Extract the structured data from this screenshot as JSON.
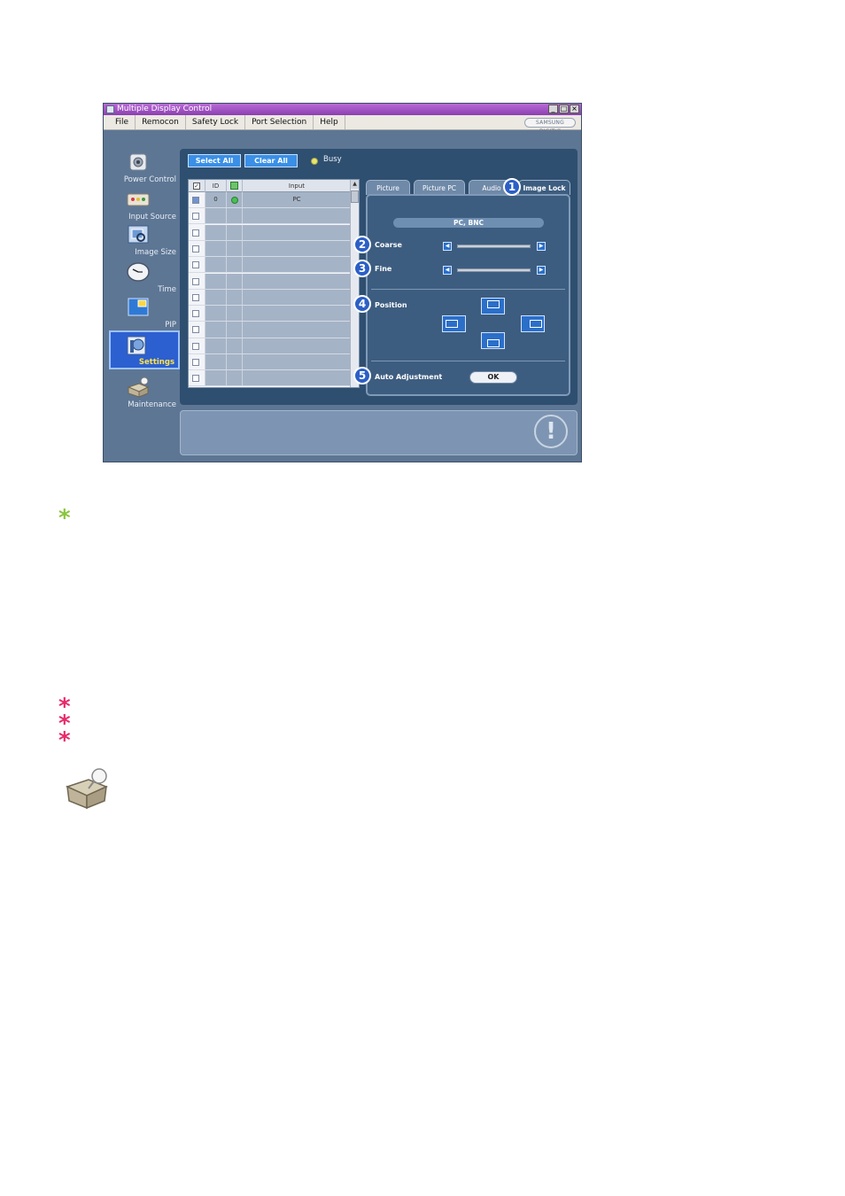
{
  "window": {
    "title": "Multiple Display Control",
    "controls": {
      "minimize": "_",
      "maximize": "□",
      "close": "×"
    }
  },
  "menu": [
    "File",
    "Remocon",
    "Safety Lock",
    "Port Selection",
    "Help"
  ],
  "brand": "SAMSUNG DIGITall",
  "sidebar": [
    {
      "label": "Power Control",
      "icon": "power-control-icon"
    },
    {
      "label": "Input Source",
      "icon": "input-source-icon"
    },
    {
      "label": "Image Size",
      "icon": "image-size-icon"
    },
    {
      "label": "Time",
      "icon": "clock-icon"
    },
    {
      "label": "PIP",
      "icon": "pip-icon"
    },
    {
      "label": "Settings",
      "icon": "settings-icon",
      "active": true
    },
    {
      "label": "Maintenance",
      "icon": "maintenance-icon"
    }
  ],
  "toolbar": {
    "select_all": "Select All",
    "clear_all": "Clear All",
    "busy_label": "Busy",
    "busy_color": "#e8e66a"
  },
  "table": {
    "columns": [
      "ID",
      "Input"
    ],
    "rows": [
      {
        "checked": true,
        "id": "0",
        "status": "on",
        "input": "PC"
      },
      {
        "checked": false,
        "id": "",
        "status": "",
        "input": ""
      },
      {
        "checked": false,
        "id": "",
        "status": "",
        "input": ""
      },
      {
        "checked": false,
        "id": "",
        "status": "",
        "input": ""
      },
      {
        "checked": false,
        "id": "",
        "status": "",
        "input": ""
      },
      {
        "checked": false,
        "id": "",
        "status": "",
        "input": ""
      },
      {
        "checked": false,
        "id": "",
        "status": "",
        "input": ""
      },
      {
        "checked": false,
        "id": "",
        "status": "",
        "input": ""
      },
      {
        "checked": false,
        "id": "",
        "status": "",
        "input": ""
      },
      {
        "checked": false,
        "id": "",
        "status": "",
        "input": ""
      },
      {
        "checked": false,
        "id": "",
        "status": "",
        "input": ""
      },
      {
        "checked": false,
        "id": "",
        "status": "",
        "input": ""
      }
    ]
  },
  "tabs": [
    {
      "label": "Picture"
    },
    {
      "label": "Picture PC"
    },
    {
      "label": "Audio"
    },
    {
      "label": "Image Lock",
      "active": true
    }
  ],
  "image_lock": {
    "source": "PC, BNC",
    "coarse_label": "Coarse",
    "fine_label": "Fine",
    "position_label": "Position",
    "auto_label": "Auto Adjustment",
    "ok_label": "OK"
  },
  "callouts": [
    "1",
    "2",
    "3",
    "4",
    "5"
  ],
  "accent_colors": {
    "active_nav": "#2c5fd0",
    "button": "#3a8fe6",
    "green_star": "#8ac43f",
    "pink_star": "#e8296a"
  }
}
